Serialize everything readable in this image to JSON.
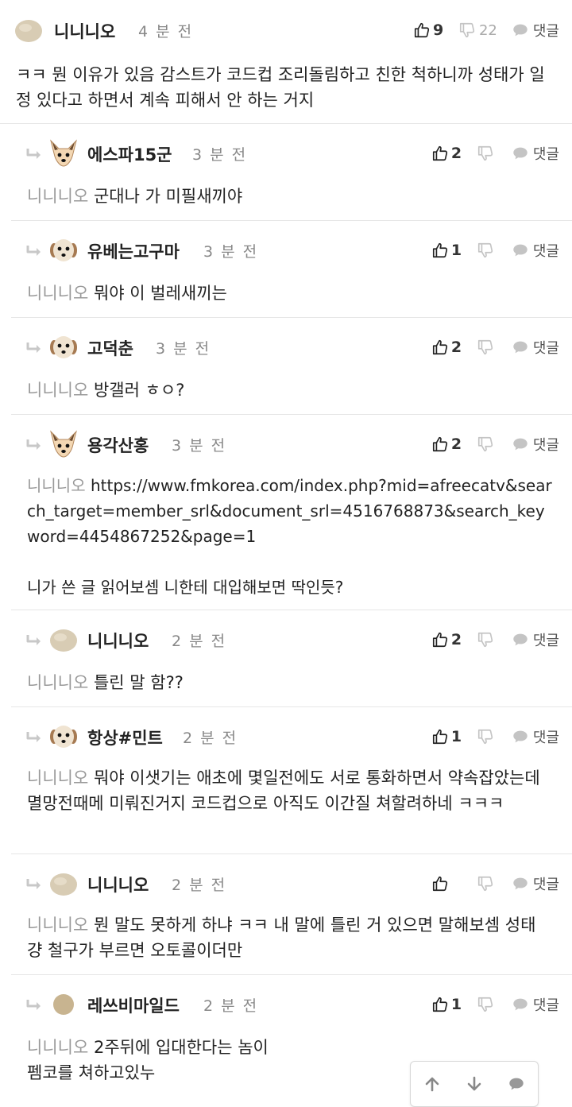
{
  "comments": [
    {
      "nick": "니니니오",
      "time": "4 분 전",
      "up": "9",
      "down": "22",
      "reply_label": "댓글",
      "mention": "",
      "text": "ㅋㅋ 뭔 이유가 있음 감스트가 코드컵 조리돌림하고 친한 척하니까 성태가 일정 있다고 하면서 계속 피해서 안 하는 거지"
    },
    {
      "nick": "에스파15군",
      "time": "3 분 전",
      "up": "2",
      "down": "",
      "reply_label": "댓글",
      "mention": "니니니오",
      "text": "군대나 가 미필새끼야"
    },
    {
      "nick": "유베는고구마",
      "time": "3 분 전",
      "up": "1",
      "down": "",
      "reply_label": "댓글",
      "mention": "니니니오",
      "text": "뭐야 이 벌레새끼는"
    },
    {
      "nick": "고덕춘",
      "time": "3 분 전",
      "up": "2",
      "down": "",
      "reply_label": "댓글",
      "mention": "니니니오",
      "text": "방갤러 ㅎㅇ?"
    },
    {
      "nick": "용각산홍",
      "time": "3 분 전",
      "up": "2",
      "down": "",
      "reply_label": "댓글",
      "mention": "니니니오",
      "text": "https://www.fmkorea.com/index.php?mid=afreecatv&search_target=member_srl&document_srl=4516768873&search_keyword=4454867252&page=1\n\n니가 쓴 글 읽어보셈 니한테 대입해보면 딱인듯?"
    },
    {
      "nick": "니니니오",
      "time": "2 분 전",
      "up": "2",
      "down": "",
      "reply_label": "댓글",
      "mention": "니니니오",
      "text": "틀린 말 함??"
    },
    {
      "nick": "항상#민트",
      "time": "2 분 전",
      "up": "1",
      "down": "",
      "reply_label": "댓글",
      "mention": "니니니오",
      "text": "뭐야 이샛기는 애초에 몇일전에도 서로 통화하면서 약속잡았는데 멸망전때메 미뤄진거지 코드컵으로 아직도 이간질 쳐할려하네 ㅋㅋㅋ"
    },
    {
      "nick": "니니니오",
      "time": "2 분 전",
      "up": "",
      "down": "",
      "reply_label": "댓글",
      "mention": "니니니오",
      "text": "뭔 말도 못하게 하냐 ㅋㅋ 내 말에 틀린 거 있으면 말해보셈 성태 걍 철구가 부르면 오토콜이더만"
    },
    {
      "nick": "레쓰비마일드",
      "time": "2 분 전",
      "up": "1",
      "down": "",
      "reply_label": "댓글",
      "mention": "니니니오",
      "text": "2주뒤에 입대한다는 놈이\n펨코를 쳐하고있누"
    }
  ],
  "icons": {
    "upvote": "thumbs-up-icon",
    "downvote": "thumbs-down-icon",
    "reply": "speech-bubble-icon",
    "reply_indicator": "reply-arrow-icon",
    "scroll_up": "arrow-up-icon",
    "scroll_down": "arrow-down-icon",
    "comment": "comment-icon"
  },
  "colors": {
    "text": "#222222",
    "muted": "#999999",
    "divider": "#e6e6e6",
    "icon": "#c4c4c4"
  }
}
